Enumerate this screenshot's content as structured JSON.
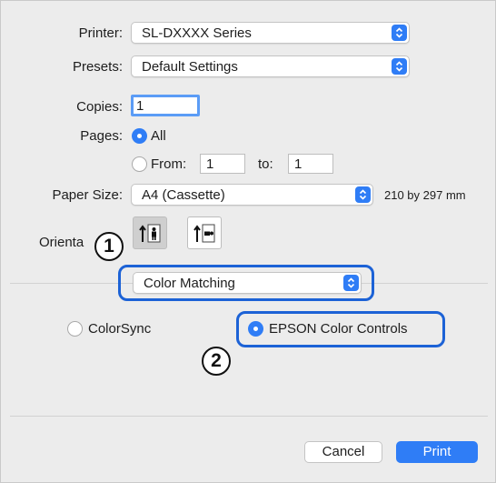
{
  "printer": {
    "label": "Printer:",
    "value": "SL-DXXXX Series"
  },
  "presets": {
    "label": "Presets:",
    "value": "Default Settings"
  },
  "copies": {
    "label": "Copies:",
    "value": "1"
  },
  "pages": {
    "label": "Pages:",
    "all_label": "All",
    "from_label": "From:",
    "from_value": "1",
    "to_label": "to:",
    "to_value": "1",
    "selected": "All"
  },
  "paper_size": {
    "label": "Paper Size:",
    "value": "A4 (Cassette)",
    "dimensions": "210 by 297 mm"
  },
  "orientation": {
    "label": "Orienta",
    "selected": "portrait"
  },
  "panel": {
    "value": "Color Matching"
  },
  "color_matching": {
    "colorsync_label": "ColorSync",
    "epson_label": "EPSON Color Controls",
    "selected": "EPSON Color Controls"
  },
  "callouts": {
    "one": "1",
    "two": "2"
  },
  "footer": {
    "cancel_label": "Cancel",
    "print_label": "Print"
  },
  "colors": {
    "accent": "#2f7df6",
    "highlight": "#1c62d6"
  }
}
